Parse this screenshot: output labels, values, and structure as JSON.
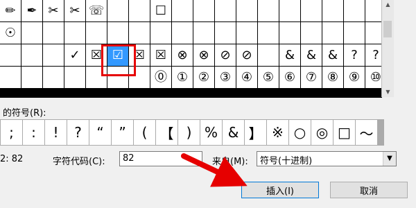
{
  "symbol_grid": {
    "rows": [
      [
        "✏",
        "✒",
        "✂",
        "✂",
        "☏",
        "",
        "",
        "☐",
        "",
        "",
        "",
        "",
        "",
        "",
        "",
        "",
        "",
        ""
      ],
      [
        "☉",
        "",
        "",
        "",
        "",
        "",
        "",
        "",
        "",
        "",
        "",
        "",
        "",
        "",
        "",
        "",
        "",
        ""
      ],
      [
        "",
        "",
        "",
        "✓",
        "☒",
        "☑",
        "☒",
        "☒",
        "⊗",
        "⊗",
        "⊘",
        "⊘",
        "",
        "&",
        "&",
        "&",
        "?",
        "?"
      ],
      [
        "",
        "",
        "",
        "",
        "",
        "",
        "",
        "⓪",
        "①",
        "②",
        "③",
        "④",
        "⑤",
        "⑥",
        "⑦",
        "⑧",
        "⑨",
        "⑩"
      ]
    ],
    "selected": {
      "row": 2,
      "col": 5
    }
  },
  "recent_label": "的符号(R):",
  "recent_symbols": [
    ";",
    ":",
    "!",
    "?",
    "“",
    "”",
    "(",
    "【",
    ")",
    "%",
    "&",
    "】",
    "※",
    "○",
    "◎",
    "□",
    "～"
  ],
  "code_left": "2: 82",
  "char_code_label": "字符代码(C):",
  "char_code_value": "82",
  "from_label": "来自(M):",
  "from_value": "符号(十进制)",
  "insert_button": "插入(I)",
  "cancel_button": "取消",
  "colors": {
    "highlight": "#3399ff",
    "annotation_red": "#e60000"
  }
}
